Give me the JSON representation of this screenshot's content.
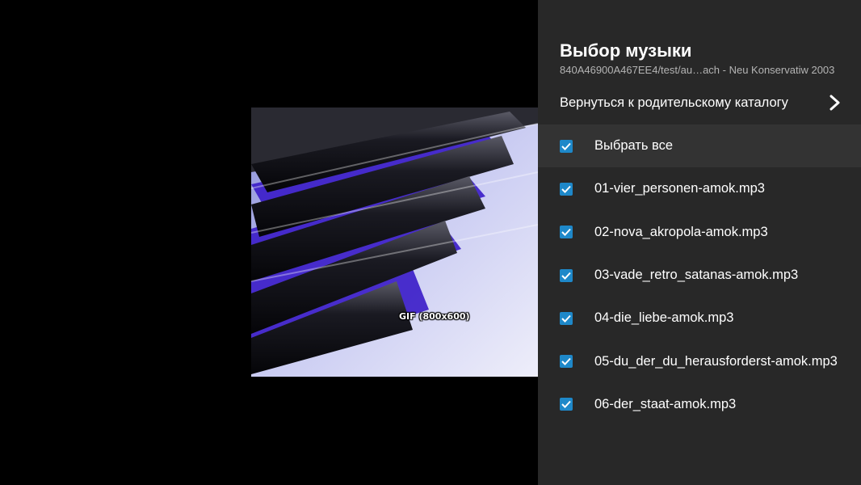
{
  "viewer": {
    "caption": "GIF (800x600)"
  },
  "panel": {
    "title": "Выбор музыки",
    "subtitle": "840A46900A467EE4/test/au…ach - Neu Konservatiw 2003",
    "parent_label": "Вернуться к родительскому каталогу",
    "select_all_label": "Выбрать все",
    "tracks": [
      "01-vier_personen-amok.mp3",
      "02-nova_akropola-amok.mp3",
      "03-vade_retro_satanas-amok.mp3",
      "04-die_liebe-amok.mp3",
      "05-du_der_du_herausforderst-amok.mp3",
      "06-der_staat-amok.mp3"
    ]
  },
  "colors": {
    "panel_bg": "#282828",
    "selected_row_bg": "#333333",
    "checkbox": "#1e88c9"
  },
  "icons": {
    "checkbox": "checkbox-checked-icon",
    "parent": "chevron-right-icon"
  }
}
